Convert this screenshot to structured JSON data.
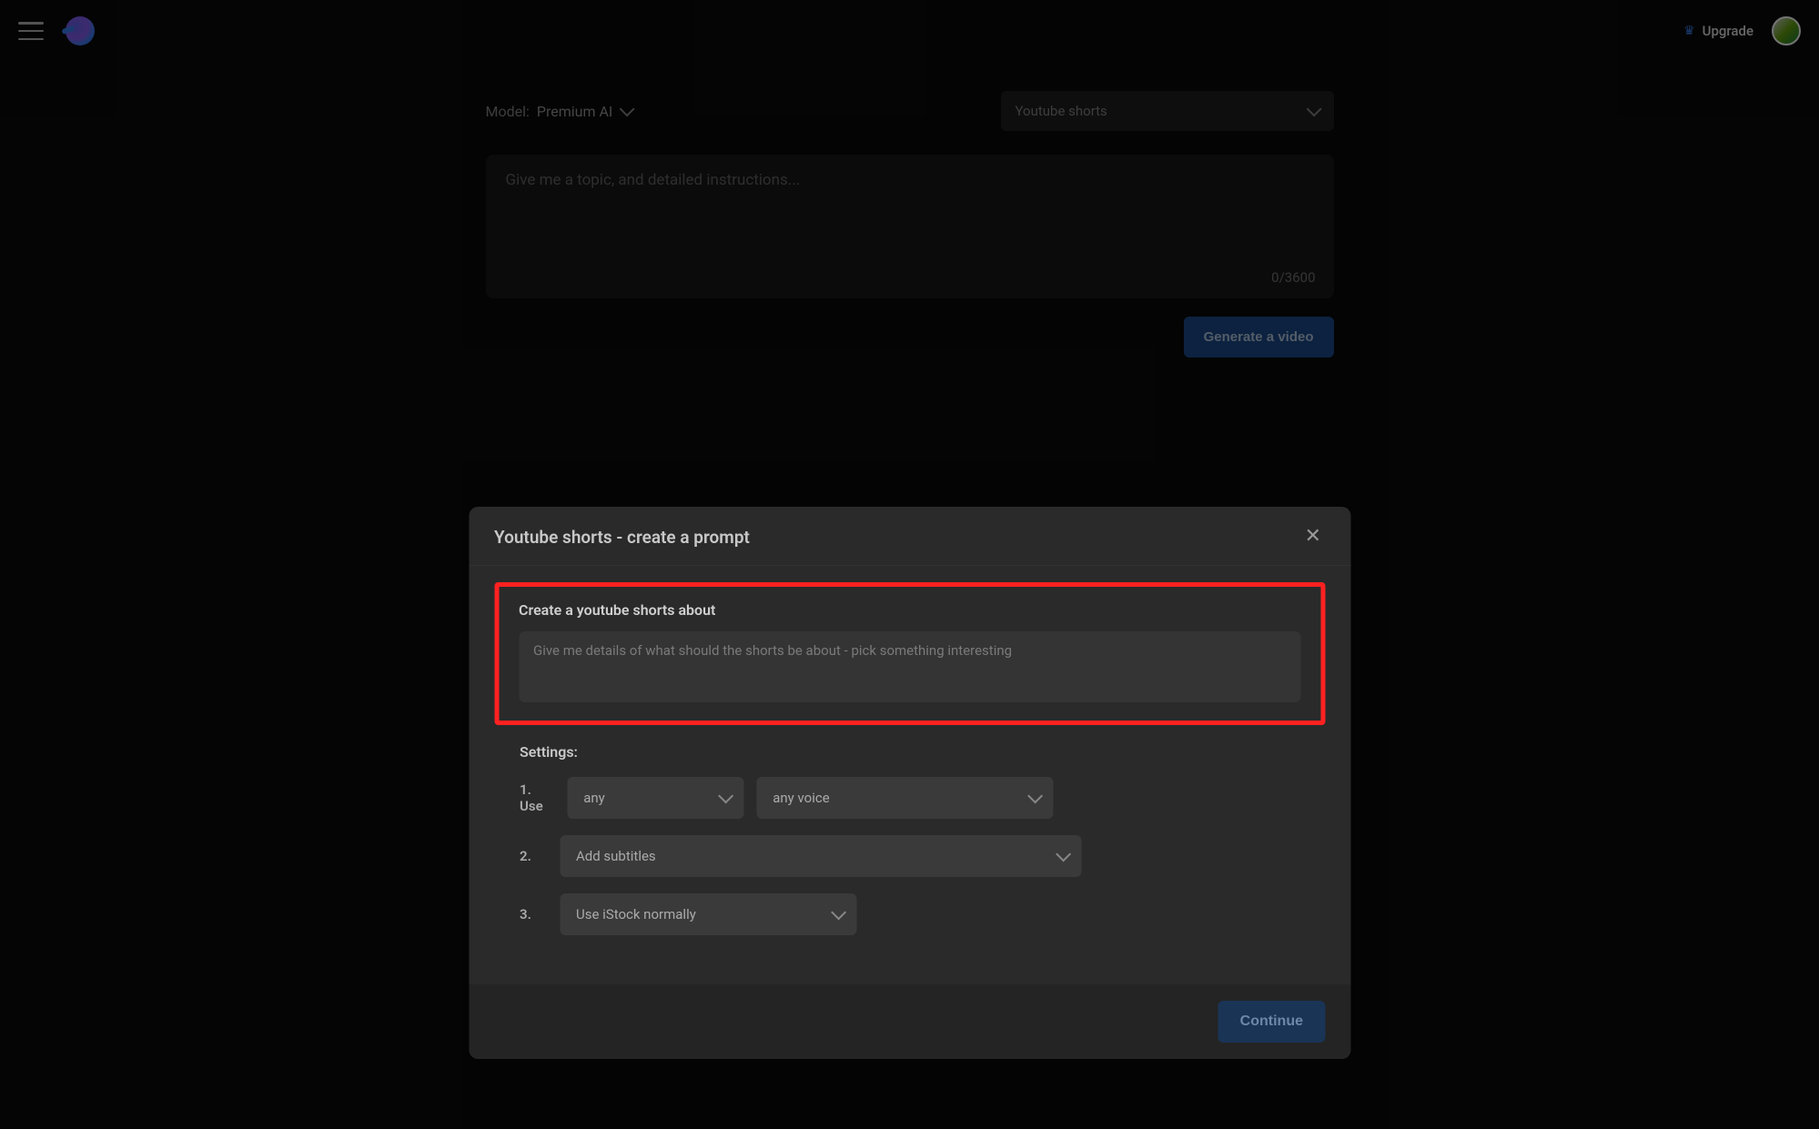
{
  "header": {
    "upgrade_label": "Upgrade"
  },
  "main": {
    "model_key": "Model:",
    "model_value": "Premium AI",
    "type_select": "Youtube shorts",
    "prompt_placeholder": "Give me a topic, and detailed instructions...",
    "char_count": "0/3600",
    "generate_button": "Generate a video"
  },
  "modal": {
    "title": "Youtube shorts - create a prompt",
    "section_label": "Create a youtube shorts about",
    "shorts_placeholder": "Give me details of what should the shorts be about - pick something interesting",
    "settings_label": "Settings:",
    "row1_num": "1.",
    "row1_use": "Use",
    "row1_dd1": "any",
    "row1_dd2": "any voice",
    "row2_num": "2.",
    "row2_dd": "Add subtitles",
    "row3_num": "3.",
    "row3_dd": "Use iStock normally",
    "continue_button": "Continue"
  }
}
